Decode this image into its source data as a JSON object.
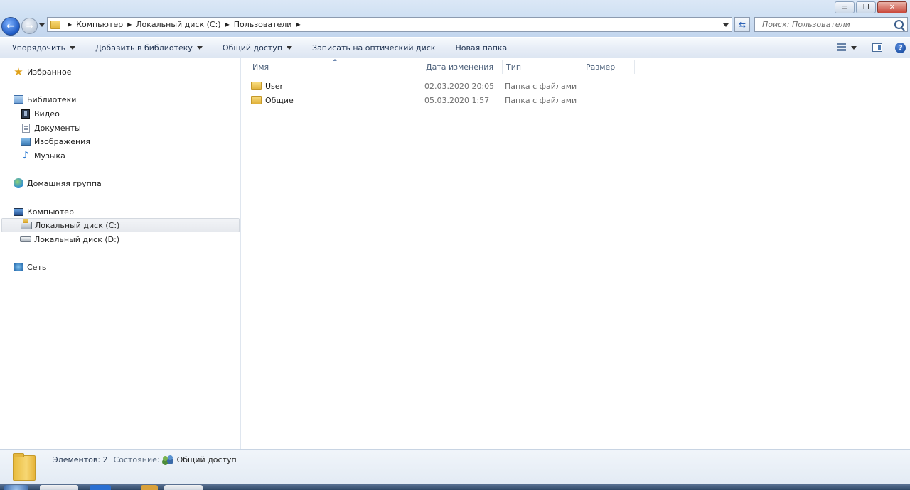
{
  "window": {
    "buttons": {
      "minimize": "▭",
      "maximize": "❐",
      "close": "✕"
    }
  },
  "address": {
    "crumbs": [
      "Компьютер",
      "Локальный диск (C:)",
      "Пользователи"
    ]
  },
  "search": {
    "placeholder": "Поиск: Пользователи"
  },
  "toolbar": {
    "organize": "Упорядочить",
    "add_library": "Добавить в библиотеку",
    "share": "Общий доступ",
    "burn": "Записать на оптический диск",
    "new_folder": "Новая папка",
    "help": "?"
  },
  "nav": {
    "favorites": "Избранное",
    "libraries": "Библиотеки",
    "video": "Видео",
    "documents": "Документы",
    "images": "Изображения",
    "music": "Музыка",
    "homegroup": "Домашняя группа",
    "computer": "Компьютер",
    "drive_c": "Локальный диск (C:)",
    "drive_d": "Локальный диск (D:)",
    "network": "Сеть"
  },
  "columns": {
    "name": "Имя",
    "date": "Дата изменения",
    "type": "Тип",
    "size": "Размер"
  },
  "files": [
    {
      "name": "User",
      "date": "02.03.2020 20:05",
      "type": "Папка с файлами"
    },
    {
      "name": "Общие",
      "date": "05.03.2020 1:57",
      "type": "Папка с файлами"
    }
  ],
  "details": {
    "count": "Элементов: 2",
    "state_label": "Состояние:",
    "state": "Общий доступ"
  },
  "colors": {
    "accent": "#1f5bc4",
    "folder": "#f7d774",
    "header_text": "#4c607a"
  }
}
